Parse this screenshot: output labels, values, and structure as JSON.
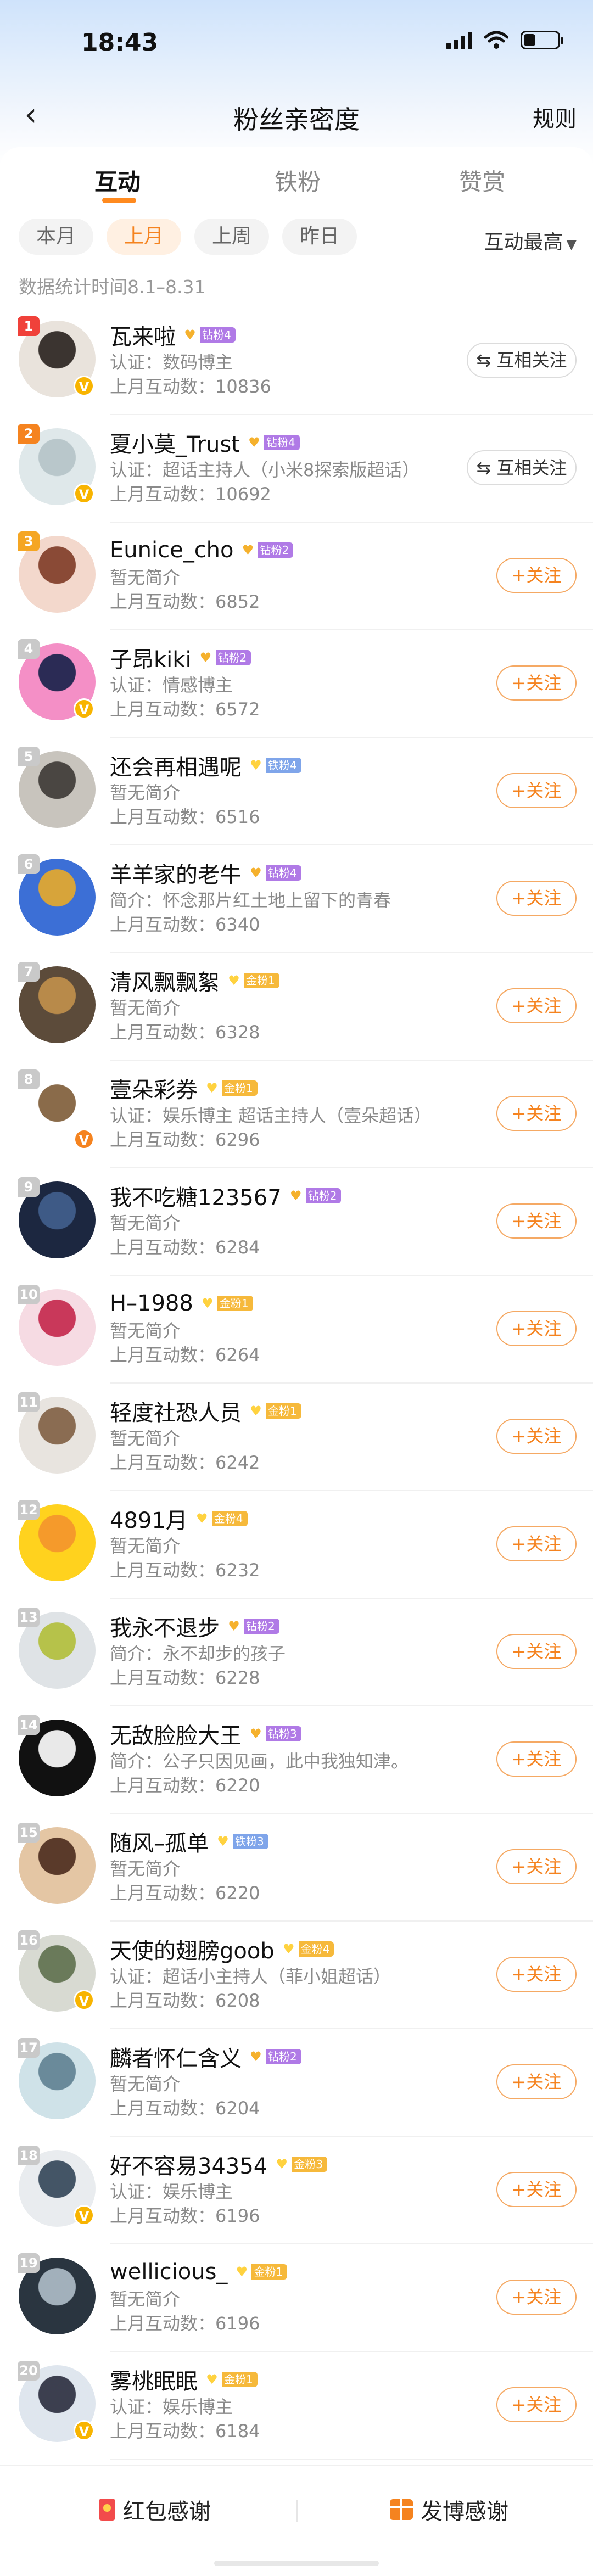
{
  "status": {
    "time": "18:43",
    "battery_level": 0.35
  },
  "nav": {
    "title": "粉丝亲密度",
    "rules": "规则"
  },
  "tabs": [
    {
      "label": "互动",
      "active": true
    },
    {
      "label": "铁粉",
      "active": false
    },
    {
      "label": "赞赏",
      "active": false
    }
  ],
  "filters": [
    {
      "label": "本月",
      "active": false
    },
    {
      "label": "上月",
      "active": true
    },
    {
      "label": "上周",
      "active": false
    },
    {
      "label": "昨日",
      "active": false
    }
  ],
  "sort": {
    "label": "互动最高"
  },
  "stat_time": "数据统计时间8.1–8.31",
  "users": [
    {
      "rank": "1",
      "name": "瓦来啦",
      "badge_level": "钻粉4",
      "badge_color": "purple",
      "desc": "认证：数码博主",
      "count": "上月互动数：10836",
      "button": "互相关注",
      "button_type": "mutual",
      "verified": "yellow",
      "avatar_colors": [
        "#e9e3dc",
        "#3b3430"
      ]
    },
    {
      "rank": "2",
      "name": "夏小莫_Trust",
      "badge_level": "钻粉4",
      "badge_color": "purple",
      "desc": "认证：超话主持人（小米8探索版超话）",
      "count": "上月互动数：10692",
      "button": "互相关注",
      "button_type": "mutual",
      "verified": "yellow",
      "avatar_colors": [
        "#dfe8ea",
        "#b9c7cb"
      ]
    },
    {
      "rank": "3",
      "name": "Eunice_cho",
      "badge_level": "钻粉2",
      "badge_color": "purple",
      "desc": "暂无简介",
      "count": "上月互动数：6852",
      "button": "+关注",
      "button_type": "follow",
      "verified": "",
      "avatar_colors": [
        "#f3d8cc",
        "#8a4a36"
      ]
    },
    {
      "rank": "4",
      "name": "子昂kiki",
      "badge_level": "钻粉2",
      "badge_color": "purple",
      "desc": "认证：情感博主",
      "count": "上月互动数：6572",
      "button": "+关注",
      "button_type": "follow",
      "verified": "yellow",
      "avatar_colors": [
        "#f48fc6",
        "#2b2b55"
      ]
    },
    {
      "rank": "5",
      "name": "还会再相遇呢",
      "badge_level": "铁粉4",
      "badge_color": "blue",
      "desc": "暂无简介",
      "count": "上月互动数：6516",
      "button": "+关注",
      "button_type": "follow",
      "verified": "",
      "avatar_colors": [
        "#c8c4bd",
        "#4a4642"
      ]
    },
    {
      "rank": "6",
      "name": "羊羊家的老牛",
      "badge_level": "钻粉4",
      "badge_color": "purple",
      "desc": "简介：怀念那片红土地上留下的青春",
      "count": "上月互动数：6340",
      "button": "+关注",
      "button_type": "follow",
      "verified": "",
      "avatar_colors": [
        "#3c6fd6",
        "#d7a43a"
      ]
    },
    {
      "rank": "7",
      "name": "清风飘飘絮",
      "badge_level": "金粉1",
      "badge_color": "yellow",
      "desc": "暂无简介",
      "count": "上月互动数：6328",
      "button": "+关注",
      "button_type": "follow",
      "verified": "",
      "avatar_colors": [
        "#5c4b3a",
        "#b88a4a"
      ]
    },
    {
      "rank": "8",
      "name": "壹朵彩券",
      "badge_level": "金粉1",
      "badge_color": "yellow",
      "desc": "认证：娱乐博主 超话主持人（壹朵超话）",
      "count": "上月互动数：6296",
      "button": "+关注",
      "button_type": "follow",
      "verified": "orange",
      "avatar_colors": [
        "#ffffff",
        "#8a6b4a"
      ]
    },
    {
      "rank": "9",
      "name": "我不吃糖123567",
      "badge_level": "钻粉2",
      "badge_color": "purple",
      "desc": "暂无简介",
      "count": "上月互动数：6284",
      "button": "+关注",
      "button_type": "follow",
      "verified": "",
      "avatar_colors": [
        "#1c2740",
        "#3e5a86"
      ]
    },
    {
      "rank": "10",
      "name": "H–1988",
      "badge_level": "金粉1",
      "badge_color": "yellow",
      "desc": "暂无简介",
      "count": "上月互动数：6264",
      "button": "+关注",
      "button_type": "follow",
      "verified": "",
      "avatar_colors": [
        "#f6dbe3",
        "#c9385a"
      ]
    },
    {
      "rank": "11",
      "name": "轻度社恐人员",
      "badge_level": "金粉1",
      "badge_color": "yellow",
      "desc": "暂无简介",
      "count": "上月互动数：6242",
      "button": "+关注",
      "button_type": "follow",
      "verified": "",
      "avatar_colors": [
        "#e8e4df",
        "#8a6c52"
      ]
    },
    {
      "rank": "12",
      "name": "4891月",
      "badge_level": "金粉4",
      "badge_color": "yellow",
      "desc": "暂无简介",
      "count": "上月互动数：6232",
      "button": "+关注",
      "button_type": "follow",
      "verified": "",
      "avatar_colors": [
        "#ffd21e",
        "#f59a2b"
      ]
    },
    {
      "rank": "13",
      "name": "我永不退步",
      "badge_level": "钻粉2",
      "badge_color": "purple",
      "desc": "简介：永不却步的孩子",
      "count": "上月互动数：6228",
      "button": "+关注",
      "button_type": "follow",
      "verified": "",
      "avatar_colors": [
        "#dfe3e6",
        "#b6c24a"
      ]
    },
    {
      "rank": "14",
      "name": "无敌脸脸大王",
      "badge_level": "钻粉3",
      "badge_color": "purple",
      "desc": "简介：公子只因见画，此中我独知津。",
      "count": "上月互动数：6220",
      "button": "+关注",
      "button_type": "follow",
      "verified": "",
      "avatar_colors": [
        "#111111",
        "#e9e9e9"
      ]
    },
    {
      "rank": "15",
      "name": "随风–孤单",
      "badge_level": "铁粉3",
      "badge_color": "blue",
      "desc": "暂无简介",
      "count": "上月互动数：6220",
      "button": "+关注",
      "button_type": "follow",
      "verified": "",
      "avatar_colors": [
        "#e4c6a4",
        "#5a3a2a"
      ]
    },
    {
      "rank": "16",
      "name": "天使的翅膀goob",
      "badge_level": "金粉4",
      "badge_color": "yellow",
      "desc": "认证：超话小主持人（菲小姐超话）",
      "count": "上月互动数：6208",
      "button": "+关注",
      "button_type": "follow",
      "verified": "yellow",
      "avatar_colors": [
        "#d8dad2",
        "#6a7a5a"
      ]
    },
    {
      "rank": "17",
      "name": "麟者怀仁含义",
      "badge_level": "钻粉2",
      "badge_color": "purple",
      "desc": "暂无简介",
      "count": "上月互动数：6204",
      "button": "+关注",
      "button_type": "follow",
      "verified": "",
      "avatar_colors": [
        "#cfe2e8",
        "#6a8a9a"
      ]
    },
    {
      "rank": "18",
      "name": "好不容易34354",
      "badge_level": "金粉3",
      "badge_color": "yellow",
      "desc": "认证：娱乐博主",
      "count": "上月互动数：6196",
      "button": "+关注",
      "button_type": "follow",
      "verified": "yellow",
      "avatar_colors": [
        "#e9ecef",
        "#445566"
      ]
    },
    {
      "rank": "19",
      "name": "wellicious_",
      "badge_level": "金粉1",
      "badge_color": "yellow",
      "desc": "暂无简介",
      "count": "上月互动数：6196",
      "button": "+关注",
      "button_type": "follow",
      "verified": "",
      "avatar_colors": [
        "#2a3540",
        "#a2b0bb"
      ]
    },
    {
      "rank": "20",
      "name": "雾桃眠眠",
      "badge_level": "金粉1",
      "badge_color": "yellow",
      "desc": "认证：娱乐博主",
      "count": "上月互动数：6184",
      "button": "+关注",
      "button_type": "follow",
      "verified": "yellow",
      "avatar_colors": [
        "#dfe6ee",
        "#3c3f4f"
      ]
    }
  ],
  "bottom_bar": {
    "left_label": "红包感谢",
    "right_label": "发博感谢"
  },
  "colors": {
    "accent": "#f5831f",
    "mutual_border": "#dcdcdc"
  }
}
